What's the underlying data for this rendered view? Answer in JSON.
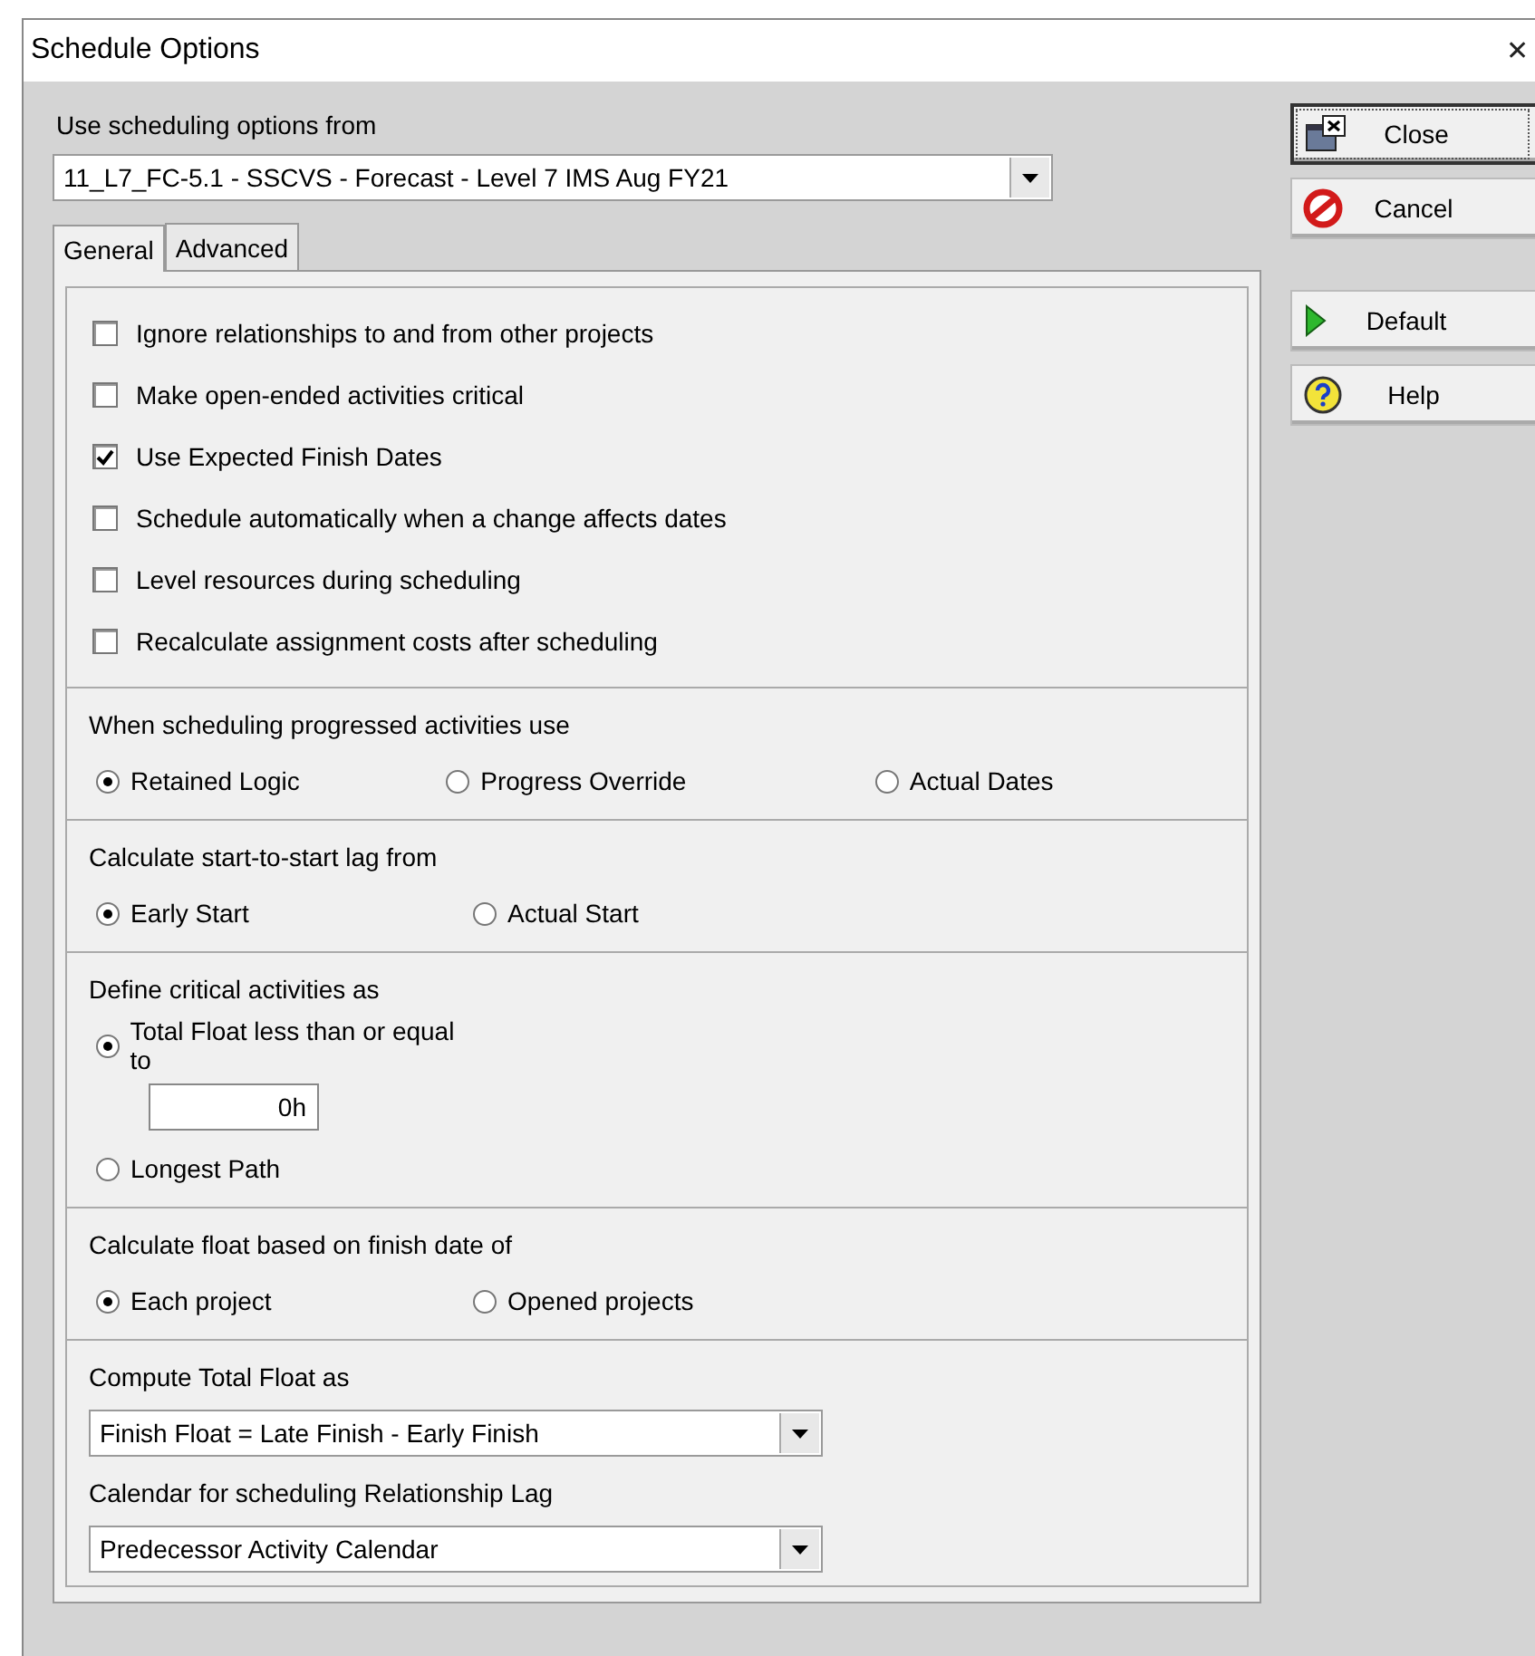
{
  "window": {
    "title": "Schedule Options",
    "close_glyph": "✕"
  },
  "options_from": {
    "label": "Use scheduling options from",
    "value": "11_L7_FC-5.1 - SSCVS - Forecast - Level 7 IMS Aug FY21"
  },
  "tabs": [
    {
      "label": "General",
      "selected": true
    },
    {
      "label": "Advanced",
      "selected": false
    }
  ],
  "sections": [
    {
      "kind": "checks",
      "items": [
        {
          "label": "Ignore relationships to and from other projects",
          "checked": false
        },
        {
          "label": "Make open-ended activities critical",
          "checked": false
        },
        {
          "label": "Use Expected Finish Dates",
          "checked": true
        },
        {
          "label": "Schedule automatically when a change affects dates",
          "checked": false
        },
        {
          "label": "Level resources during scheduling",
          "checked": false
        },
        {
          "label": "Recalculate assignment costs after scheduling",
          "checked": false
        }
      ]
    },
    {
      "kind": "radios",
      "title": "When scheduling progressed activities use",
      "options": [
        {
          "label": "Retained Logic",
          "selected": true
        },
        {
          "label": "Progress Override",
          "selected": false
        },
        {
          "label": "Actual Dates",
          "selected": false
        }
      ]
    },
    {
      "kind": "radios",
      "title": "Calculate start-to-start lag from",
      "options": [
        {
          "label": "Early Start",
          "selected": true
        },
        {
          "label": "Actual Start",
          "selected": false
        }
      ]
    },
    {
      "kind": "critical",
      "title": "Define critical activities as",
      "options": [
        {
          "label": "Total Float less than or equal to",
          "selected": true,
          "value": "0h"
        },
        {
          "label": "Longest Path",
          "selected": false
        }
      ]
    },
    {
      "kind": "radios",
      "title": "Calculate float based on finish date of",
      "options": [
        {
          "label": "Each project",
          "selected": true
        },
        {
          "label": "Opened projects",
          "selected": false
        }
      ]
    },
    {
      "kind": "selects",
      "fields": [
        {
          "label": "Compute Total Float as",
          "value": "Finish Float = Late Finish - Early Finish"
        },
        {
          "label": "Calendar for scheduling Relationship Lag",
          "value": "Predecessor Activity Calendar"
        }
      ]
    }
  ],
  "buttons": [
    {
      "label": "Close",
      "kind": "close",
      "focused": true
    },
    {
      "label": "Cancel",
      "kind": "cancel",
      "focused": false
    },
    {
      "label": "Default",
      "kind": "default",
      "focused": false
    },
    {
      "label": "Help",
      "kind": "help",
      "focused": false
    }
  ]
}
